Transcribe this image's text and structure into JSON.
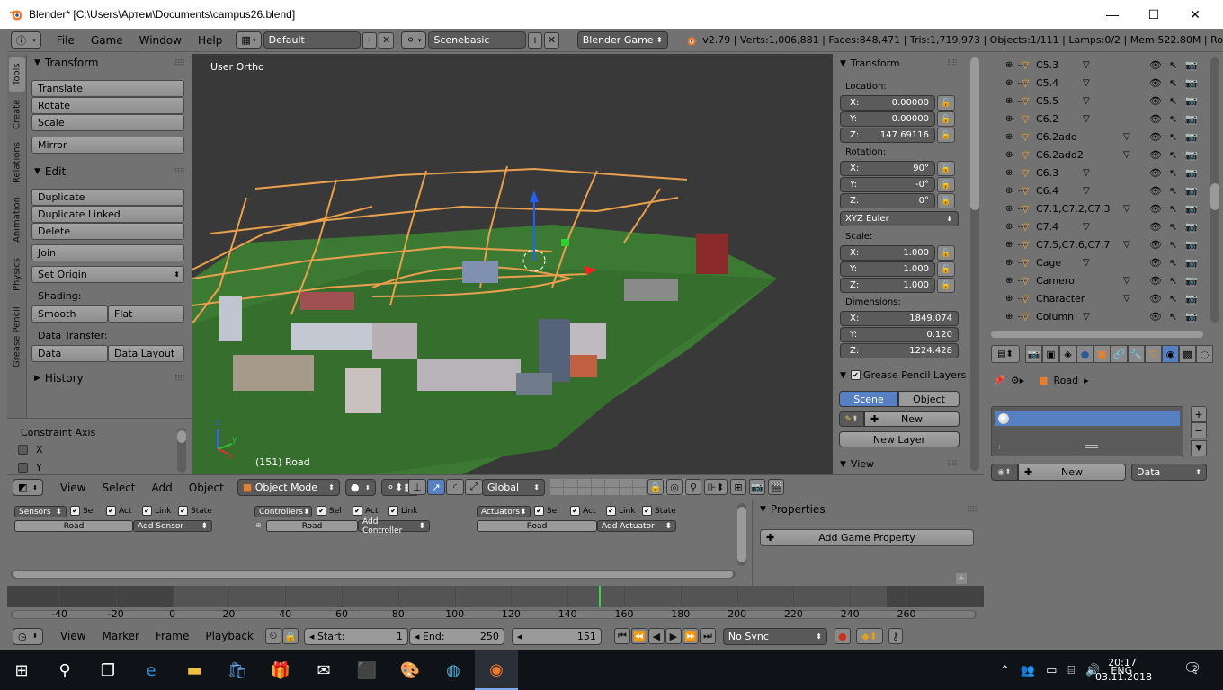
{
  "window": {
    "title": "Blender* [C:\\Users\\Артем\\Documents\\campus26.blend]",
    "minimize": "—",
    "maximize": "☐",
    "close": "✕"
  },
  "info_header": {
    "menus": [
      "File",
      "Game",
      "Window",
      "Help"
    ],
    "screen_layout": "Default",
    "scene": "Scenebasic",
    "engine": "Blender Game",
    "stats": "v2.79 | Verts:1,006,881 | Faces:848,471 | Tris:1,719,973 | Objects:1/111 | Lamps:0/2 | Mem:522.80M | Ro"
  },
  "tool_tabs": [
    "Tools",
    "Create",
    "Relations",
    "Animation",
    "Physics",
    "Grease Pencil"
  ],
  "tool_panel": {
    "transform_title": "Transform",
    "transform_buttons": [
      "Translate",
      "Rotate",
      "Scale"
    ],
    "mirror": "Mirror",
    "edit_title": "Edit",
    "edit_buttons": [
      "Duplicate",
      "Duplicate Linked",
      "Delete"
    ],
    "join": "Join",
    "set_origin": "Set Origin",
    "shading_label": "Shading:",
    "smooth": "Smooth",
    "flat": "Flat",
    "data_transfer_label": "Data Transfer:",
    "data": "Data",
    "data_layout": "Data Layout",
    "history_title": "History",
    "constraint_axis_title": "Constraint Axis",
    "axis_x": "X",
    "axis_y": "Y"
  },
  "viewport": {
    "view_label": "User Ortho",
    "object_label": "(151) Road",
    "axis_z": "z",
    "axis_y": "y",
    "axis_x": "x"
  },
  "n_panel": {
    "transform_title": "Transform",
    "location_label": "Location:",
    "location": {
      "x": "0.00000",
      "y": "0.00000",
      "z": "147.69116"
    },
    "rotation_label": "Rotation:",
    "rotation": {
      "x": "90°",
      "y": "-0°",
      "z": "0°"
    },
    "rotation_mode": "XYZ Euler",
    "scale_label": "Scale:",
    "scale": {
      "x": "1.000",
      "y": "1.000",
      "z": "1.000"
    },
    "dimensions_label": "Dimensions:",
    "dimensions": {
      "x": "1849.074",
      "y": "0.120",
      "z": "1224.428"
    },
    "grease_pencil_title": "Grease Pencil Layers",
    "scene_tab": "Scene",
    "object_tab": "Object",
    "new": "New",
    "new_layer": "New Layer",
    "view_title": "View",
    "axis_labels": [
      "X:",
      "Y:",
      "Z:"
    ]
  },
  "outliner": {
    "items": [
      {
        "name": "C5.3"
      },
      {
        "name": "C5.4"
      },
      {
        "name": "C5.5"
      },
      {
        "name": "C6.2"
      },
      {
        "name": "C6.2add"
      },
      {
        "name": "C6.2add2"
      },
      {
        "name": "C6.3"
      },
      {
        "name": "C6.4"
      },
      {
        "name": "C7.1,C7.2,C7.3"
      },
      {
        "name": "C7.4"
      },
      {
        "name": "C7.5,C7.6,C7.7"
      },
      {
        "name": "Cage"
      },
      {
        "name": "Camero"
      },
      {
        "name": "Character"
      },
      {
        "name": "Column"
      }
    ]
  },
  "properties": {
    "breadcrumb_object": "Road",
    "new_button": "New",
    "data_dropdown": "Data"
  },
  "view3d_header": {
    "menus": [
      "View",
      "Select",
      "Add",
      "Object"
    ],
    "mode": "Object Mode",
    "orientation": "Global"
  },
  "logic_editor": {
    "sensors": "Sensors",
    "controllers": "Controllers",
    "actuators": "Actuators",
    "sel": "Sel",
    "act": "Act",
    "link": "Link",
    "state": "State",
    "object_name": "Road",
    "add_sensor": "Add Sensor",
    "add_controller": "Add Controller",
    "add_actuator": "Add Actuator",
    "properties_title": "Properties",
    "add_game_property": "Add Game Property"
  },
  "timeline": {
    "ticks": [
      "-40",
      "-20",
      "0",
      "20",
      "40",
      "60",
      "80",
      "100",
      "120",
      "140",
      "160",
      "180",
      "200",
      "220",
      "240",
      "260"
    ],
    "current_frame_value": 151,
    "menus": [
      "View",
      "Marker",
      "Frame",
      "Playback"
    ],
    "start_label": "Start:",
    "start": "1",
    "end_label": "End:",
    "end": "250",
    "current": "151",
    "sync": "No Sync"
  },
  "taskbar": {
    "language": "ENG",
    "time": "20:17",
    "date": "03.11.2018",
    "notifications": "2"
  }
}
